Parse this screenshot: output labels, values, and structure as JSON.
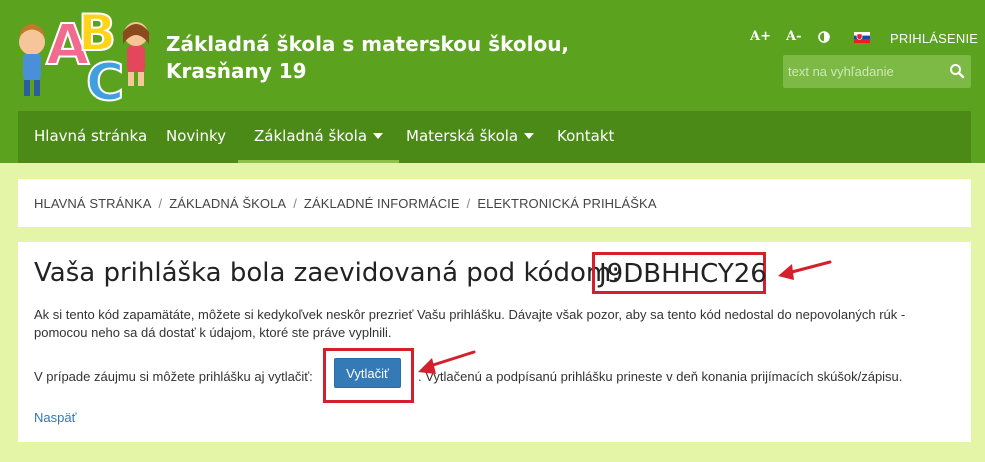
{
  "header": {
    "title_line1": "Základná škola s materskou školou,",
    "title_line2": "Krasňany 19",
    "tools": {
      "font_up": "A+",
      "font_down": "A-",
      "login": "PRIHLÁSENIE"
    },
    "search": {
      "placeholder": "text na vyhľadanie"
    }
  },
  "nav": {
    "items": [
      {
        "label": "Hlavná stránka"
      },
      {
        "label": "Novinky"
      },
      {
        "label": "Základná škola"
      },
      {
        "label": "Materská škola"
      },
      {
        "label": "Kontakt"
      }
    ]
  },
  "breadcrumb": [
    "HLAVNÁ STRÁNKA",
    "ZÁKLADNÁ ŠKOLA",
    "ZÁKLADNÉ INFORMÁCIE",
    "ELEKTRONICKÁ PRIHLÁŠKA"
  ],
  "main": {
    "headline": "Vaša prihláška bola zaevidovaná pod kódom:",
    "code": "J9DBHHCY26",
    "paragraph": "Ak si tento kód zapamätáte, môžete si kedykoľvek neskôr prezrieť Vašu prihlášku. Dávajte však pozor, aby sa tento kód nedostal do nepovolaných rúk - pomocou neho sa dá dostať k údajom, ktoré ste práve vyplnili.",
    "print_before": "V prípade záujmu si môžete prihlášku aj vytlačiť:",
    "print_button": "Vytlačiť",
    "print_after": ". Vytlačenú a podpísanú prihlášku prineste v deň konania prijímacích skúšok/zápisu.",
    "back_link": "Naspäť"
  },
  "colors": {
    "header_green": "#5ba31e",
    "nav_green": "#4b8a16",
    "page_bg": "#e4f5a8",
    "button_blue": "#337ab7",
    "highlight_red": "#d4202c"
  },
  "icons": {
    "logo": "abc-kids-logo",
    "contrast": "contrast-icon",
    "flag": "slovak-flag-icon",
    "search": "search-icon",
    "caret": "caret-down-icon"
  }
}
